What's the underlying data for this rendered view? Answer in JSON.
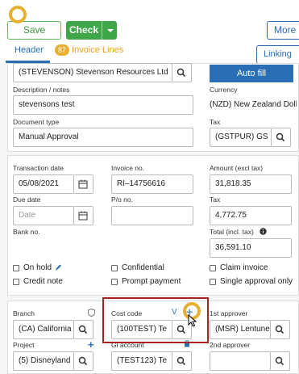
{
  "toolbar": {
    "save_label": "Save",
    "check_label": "Check",
    "more_label": "More",
    "linking_label": "Linking"
  },
  "tabs": {
    "header_label": "Header",
    "invoice_lines_count": "87",
    "invoice_lines_label": "Invoice Lines"
  },
  "supplier": {
    "value": "(STEVENSON) Stevenson Resources Ltd",
    "autofill_label": "Auto fill"
  },
  "description": {
    "label": "Description / notes",
    "value": "stevensons test"
  },
  "currency": {
    "label": "Currency",
    "value": "(NZD) New Zealand Doll"
  },
  "document_type": {
    "label": "Document type",
    "value": "Manual Approval"
  },
  "tax_code": {
    "label": "Tax",
    "value": "(GSTPUR) GS"
  },
  "transaction_date": {
    "label": "Transaction date",
    "value": "05/08/2021"
  },
  "invoice_no": {
    "label": "Invoice no.",
    "value": "RI–14756616"
  },
  "amount_excl": {
    "label": "Amount (excl tax)",
    "value": "31,818.35"
  },
  "due_date": {
    "label": "Due date",
    "placeholder": "Date"
  },
  "po_no": {
    "label": "P/o no.",
    "value": ""
  },
  "tax_amount": {
    "label": "Tax",
    "value": "4,772.75"
  },
  "bank_no": {
    "label": "Bank no."
  },
  "total": {
    "label": "Total (incl. tax)",
    "value": "36,591.10"
  },
  "checkboxes": {
    "on_hold": "On hold",
    "confidential": "Confidential",
    "claim_invoice": "Claim invoice",
    "credit_note": "Credit note",
    "prompt_payment": "Prompt payment",
    "single_approval": "Single approval only"
  },
  "branch": {
    "label": "Branch",
    "value": "(CA) California"
  },
  "cost_code": {
    "label": "Cost code",
    "value": "(100TEST) Te",
    "v_label": "V"
  },
  "first_approver": {
    "label": "1st approver",
    "value": "(MSR) Lentune"
  },
  "project": {
    "label": "Project",
    "value": "(5) Disneyland"
  },
  "gl_account": {
    "label": "Gl account",
    "value": "(TEST123) Te"
  },
  "second_approver": {
    "label": "2nd approver",
    "value": ""
  },
  "colors": {
    "accent": "#2a6fb5",
    "save_green": "#3fa74a",
    "highlight": "#a8231f",
    "marker": "#e8b030"
  }
}
